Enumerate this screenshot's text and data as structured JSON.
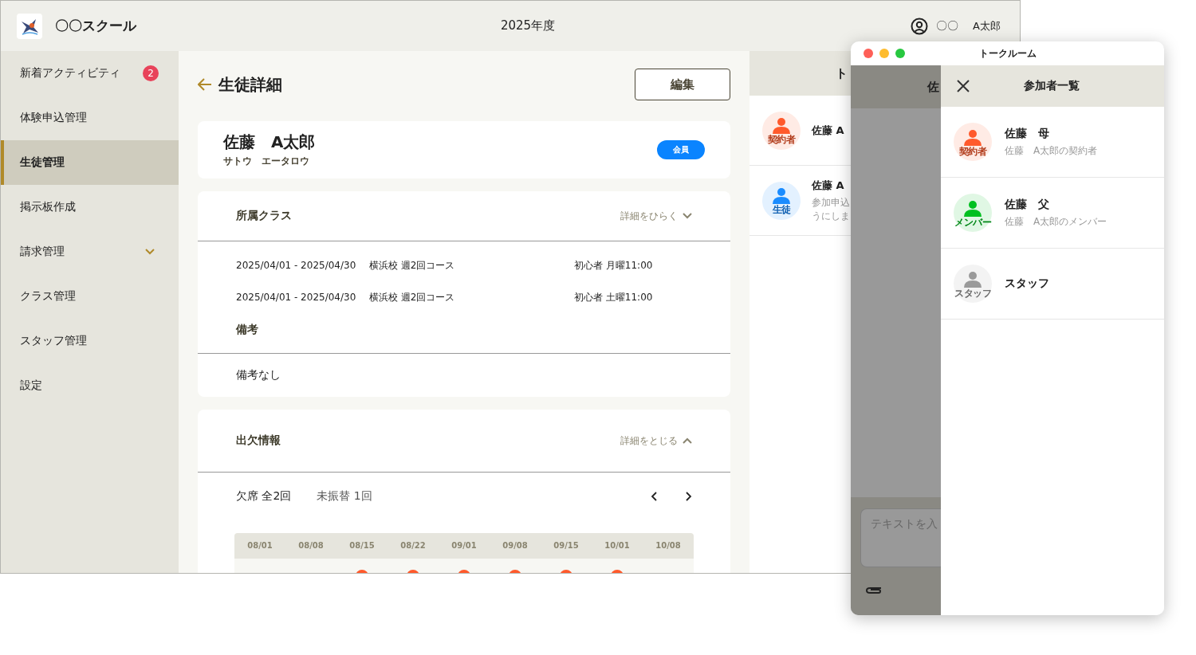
{
  "header": {
    "app_name": "〇〇スクール",
    "fiscal_year": "2025年度",
    "user_last": "〇〇",
    "user_first": "A太郎"
  },
  "sidebar": {
    "items": [
      {
        "label": "新着アクティビティ",
        "selected": false,
        "badge": "2",
        "expandable": false
      },
      {
        "label": "体験申込管理",
        "selected": false,
        "expandable": false
      },
      {
        "label": "生徒管理",
        "selected": true,
        "expandable": false
      },
      {
        "label": "掲示板作成",
        "selected": false,
        "expandable": false
      },
      {
        "label": "請求管理",
        "selected": false,
        "expandable": true
      },
      {
        "label": "クラス管理",
        "selected": false,
        "expandable": false
      },
      {
        "label": "スタッフ管理",
        "selected": false,
        "expandable": false
      },
      {
        "label": "設定",
        "selected": false,
        "expandable": false
      }
    ]
  },
  "page": {
    "title": "生徒詳細",
    "edit_button": "編集"
  },
  "student": {
    "name": "佐藤　A太郎",
    "kana": "サトウ　エータロウ",
    "badge": "会員"
  },
  "classes": {
    "title": "所属クラス",
    "toggle": "詳細をひらく",
    "expanded": false,
    "rows": [
      {
        "period": "2025/04/01 - 2025/04/30",
        "course": "横浜校 週2回コース",
        "slot": "初心者 月曜11:00"
      },
      {
        "period": "2025/04/01 - 2025/04/30",
        "course": "横浜校 週2回コース",
        "slot": "初心者 土曜11:00"
      }
    ],
    "notes_label": "備考",
    "notes": "備考なし"
  },
  "attendance": {
    "title": "出欠情報",
    "toggle": "詳細をとじる",
    "expanded": true,
    "absences": "欠席 全2回",
    "unmade": "未振替 1回",
    "dates": [
      {
        "label": "08/01",
        "marked": false
      },
      {
        "label": "08/08",
        "marked": false
      },
      {
        "label": "08/15",
        "marked": true
      },
      {
        "label": "08/22",
        "marked": true
      },
      {
        "label": "09/01",
        "marked": true
      },
      {
        "label": "09/08",
        "marked": true
      },
      {
        "label": "09/15",
        "marked": true
      },
      {
        "label": "10/01",
        "marked": true
      },
      {
        "label": "10/08",
        "marked": false
      }
    ]
  },
  "chat_panel": {
    "title": "ト",
    "rooms": [
      {
        "name": "佐藤 A",
        "role": "契約者",
        "color": "#ff5a2c"
      },
      {
        "name": "佐藤 A",
        "role": "生徒",
        "color": "#1a8cff",
        "preview": [
          "参加申込",
          "うにしま"
        ]
      }
    ]
  },
  "talk_window": {
    "title": "トークルーム",
    "room_title": "佐",
    "placeholder": "テキストを入",
    "drawer": {
      "title": "参加者一覧",
      "participants": [
        {
          "name": "佐藤　母",
          "role": "契約者",
          "color": "#ff5a2c",
          "relation": "佐藤　A太郎の契約者"
        },
        {
          "name": "佐藤　父",
          "role": "メンバー",
          "color": "#00c020",
          "relation": "佐藤　A太郎のメンバー"
        },
        {
          "name": "スタッフ",
          "role": "スタッフ",
          "color": "#9a9a9a"
        }
      ]
    }
  }
}
